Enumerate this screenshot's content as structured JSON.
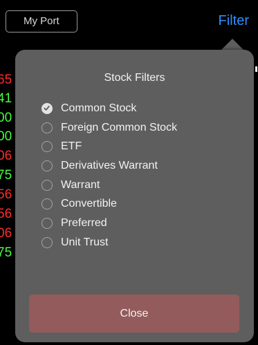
{
  "topbar": {
    "portfolio_label": "My Port",
    "filter_label": "Filter"
  },
  "background_values": [
    {
      "text": "65",
      "color": "#ff2d2d"
    },
    {
      "text": "41",
      "color": "#43ff3f"
    },
    {
      "text": "00",
      "color": "#43ff3f"
    },
    {
      "text": "00",
      "color": "#43ff3f"
    },
    {
      "text": "06",
      "color": "#ff2d2d"
    },
    {
      "text": "75",
      "color": "#43ff3f"
    },
    {
      "text": "56",
      "color": "#ff2d2d"
    },
    {
      "text": "56",
      "color": "#ff2d2d"
    },
    {
      "text": "06",
      "color": "#ff2d2d"
    },
    {
      "text": "75",
      "color": "#43ff3f"
    }
  ],
  "popover": {
    "title": "Stock Filters",
    "options": [
      {
        "label": "Common Stock",
        "checked": true
      },
      {
        "label": "Foreign Common Stock",
        "checked": false
      },
      {
        "label": "ETF",
        "checked": false
      },
      {
        "label": "Derivatives Warrant",
        "checked": false
      },
      {
        "label": "Warrant",
        "checked": false
      },
      {
        "label": "Convertible",
        "checked": false
      },
      {
        "label": "Preferred",
        "checked": false
      },
      {
        "label": "Unit Trust",
        "checked": false
      }
    ],
    "close_label": "Close"
  },
  "colors": {
    "accent": "#2f8fff",
    "popover_bg": "#5e5e5e",
    "close_button": "#945b5c",
    "gain": "#43ff3f",
    "loss": "#ff2d2d"
  }
}
